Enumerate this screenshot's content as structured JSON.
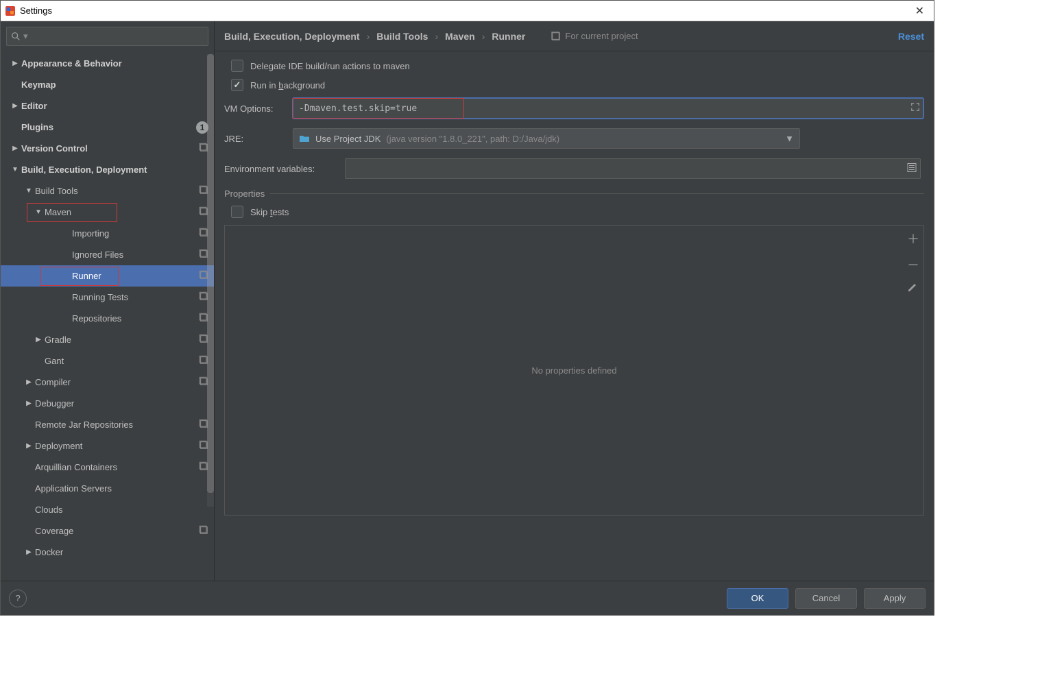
{
  "window": {
    "title": "Settings"
  },
  "sidebar": {
    "search_placeholder": "",
    "items": [
      {
        "label": "Appearance & Behavior",
        "depth": 0,
        "arrow": "right",
        "bold": true
      },
      {
        "label": "Keymap",
        "depth": 0,
        "arrow": "",
        "bold": true
      },
      {
        "label": "Editor",
        "depth": 0,
        "arrow": "right",
        "bold": true
      },
      {
        "label": "Plugins",
        "depth": 0,
        "arrow": "",
        "bold": true,
        "badge": "1"
      },
      {
        "label": "Version Control",
        "depth": 0,
        "arrow": "right",
        "bold": true,
        "proj": true
      },
      {
        "label": "Build, Execution, Deployment",
        "depth": 0,
        "arrow": "down",
        "bold": true
      },
      {
        "label": "Build Tools",
        "depth": 1,
        "arrow": "down",
        "bold": false,
        "proj": true
      },
      {
        "label": "Maven",
        "depth": 2,
        "arrow": "down",
        "bold": false,
        "proj": true,
        "redbox": "maven"
      },
      {
        "label": "Importing",
        "depth": 3,
        "arrow": "",
        "bold": false,
        "proj": true
      },
      {
        "label": "Ignored Files",
        "depth": 3,
        "arrow": "",
        "bold": false,
        "proj": true
      },
      {
        "label": "Runner",
        "depth": 3,
        "arrow": "",
        "bold": false,
        "proj": true,
        "selected": true,
        "redbox": "runner"
      },
      {
        "label": "Running Tests",
        "depth": 3,
        "arrow": "",
        "bold": false,
        "proj": true
      },
      {
        "label": "Repositories",
        "depth": 3,
        "arrow": "",
        "bold": false,
        "proj": true
      },
      {
        "label": "Gradle",
        "depth": 2,
        "arrow": "right",
        "bold": false,
        "proj": true
      },
      {
        "label": "Gant",
        "depth": 2,
        "arrow": "",
        "bold": false,
        "proj": true
      },
      {
        "label": "Compiler",
        "depth": 1,
        "arrow": "right",
        "bold": false,
        "proj": true
      },
      {
        "label": "Debugger",
        "depth": 1,
        "arrow": "right",
        "bold": false
      },
      {
        "label": "Remote Jar Repositories",
        "depth": 1,
        "arrow": "",
        "bold": false,
        "proj": true
      },
      {
        "label": "Deployment",
        "depth": 1,
        "arrow": "right",
        "bold": false,
        "proj": true
      },
      {
        "label": "Arquillian Containers",
        "depth": 1,
        "arrow": "",
        "bold": false,
        "proj": true
      },
      {
        "label": "Application Servers",
        "depth": 1,
        "arrow": "",
        "bold": false
      },
      {
        "label": "Clouds",
        "depth": 1,
        "arrow": "",
        "bold": false
      },
      {
        "label": "Coverage",
        "depth": 1,
        "arrow": "",
        "bold": false,
        "proj": true
      },
      {
        "label": "Docker",
        "depth": 1,
        "arrow": "right",
        "bold": false
      }
    ]
  },
  "breadcrumb": {
    "parts": [
      "Build, Execution, Deployment",
      "Build Tools",
      "Maven",
      "Runner"
    ],
    "for_project": "For current project",
    "reset": "Reset"
  },
  "form": {
    "delegate_label": "Delegate IDE build/run actions to maven",
    "delegate_checked": false,
    "runbg_prefix": "Run in ",
    "runbg_u": "b",
    "runbg_suffix": "ackground",
    "runbg_checked": true,
    "vm_label": "VM Options:",
    "vm_value": "-Dmaven.test.skip=true",
    "jre_label": "JRE:",
    "jre_value": "Use Project JDK ",
    "jre_hint": "(java version \"1.8.0_221\", path: D:/Java/jdk)",
    "env_label": "Environment variables:",
    "env_value": "",
    "props_title": "Properties",
    "skip_prefix": "Skip ",
    "skip_u": "t",
    "skip_suffix": "ests",
    "skip_checked": false,
    "props_empty": "No properties defined"
  },
  "footer": {
    "ok": "OK",
    "cancel": "Cancel",
    "apply": "Apply"
  }
}
